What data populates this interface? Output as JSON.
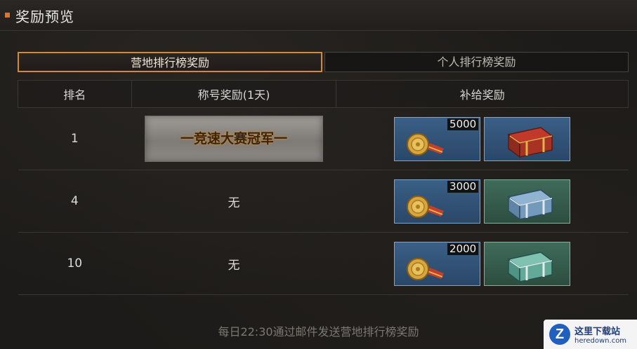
{
  "header": {
    "title": "奖励预览"
  },
  "tabs": [
    {
      "label": "营地排行榜奖励",
      "active": true
    },
    {
      "label": "个人排行榜奖励",
      "active": false
    }
  ],
  "table": {
    "columns": [
      "排名",
      "称号奖励(1天)",
      "补给奖励"
    ],
    "rows": [
      {
        "rank": "1",
        "title_reward": "一竞速大赛冠军一",
        "items": [
          {
            "icon": "medal-icon",
            "qty": "5000"
          },
          {
            "icon": "red-chest-icon"
          }
        ]
      },
      {
        "rank": "4",
        "title_reward": "无",
        "items": [
          {
            "icon": "medal-icon",
            "qty": "3000"
          },
          {
            "icon": "blue-chest-icon"
          }
        ]
      },
      {
        "rank": "10",
        "title_reward": "无",
        "items": [
          {
            "icon": "medal-icon",
            "qty": "2000"
          },
          {
            "icon": "teal-chest-icon"
          }
        ]
      }
    ]
  },
  "footer": {
    "note": "每日22:30通过邮件发送营地排行榜奖励"
  },
  "watermark": {
    "cn": "这里下载站",
    "en": "heredown.com"
  },
  "colors": {
    "accent": "#d9762a",
    "active_tab_border": "#d08a3c",
    "item_blue": "#3a5f86",
    "item_green": "#3f6b5a"
  }
}
